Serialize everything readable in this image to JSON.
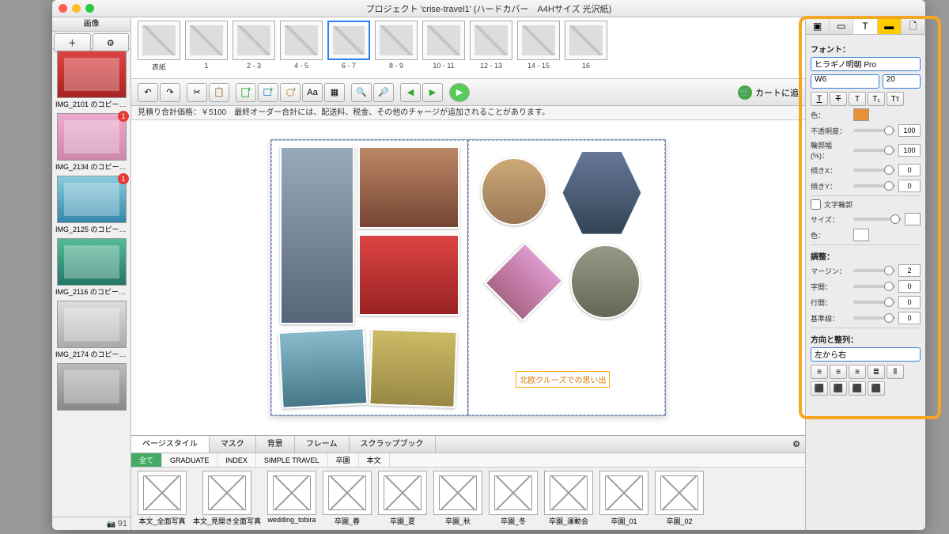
{
  "title": "プロジェクト 'crise-travel1' (ハードカバー　A4Hサイズ 光沢紙)",
  "sidebar": {
    "header": "画像",
    "count": "91",
    "items": [
      {
        "cap": "IMG_2101 のコピー-J...",
        "badge": ""
      },
      {
        "cap": "IMG_2134 のコピー-J...",
        "badge": "1"
      },
      {
        "cap": "IMG_2125 のコピー-J...",
        "badge": "1"
      },
      {
        "cap": "IMG_2116 のコピー-J...",
        "badge": ""
      },
      {
        "cap": "IMG_2174 のコピー-J...",
        "badge": ""
      },
      {
        "cap": "",
        "badge": ""
      }
    ]
  },
  "pages": [
    {
      "label": "表紙"
    },
    {
      "label": "1"
    },
    {
      "label": "2 - 3"
    },
    {
      "label": "4 - 5"
    },
    {
      "label": "6 - 7",
      "sel": true
    },
    {
      "label": "8 - 9"
    },
    {
      "label": "10 - 11"
    },
    {
      "label": "12 - 13"
    },
    {
      "label": "14 - 15"
    },
    {
      "label": "16"
    }
  ],
  "toolbar": {
    "cart": "カートに追"
  },
  "infobar": "見積り合計価格：￥5100　最終オーダー合計には、配送料、税金、その他のチャージが追加されることがあります。",
  "textbox": "北欧クルーズでの思い出",
  "bottomTabs": [
    "ページスタイル",
    "マスク",
    "背景",
    "フレーム",
    "スクラップブック"
  ],
  "filters": [
    "全て",
    "GRADUATE",
    "INDEX",
    "SIMPLE TRAVEL",
    "卒園",
    "本文"
  ],
  "templates": [
    "本文_全面写真",
    "本文_見開き全面写真",
    "wedding_tobira",
    "卒園_春",
    "卒園_夏",
    "卒園_秋",
    "卒園_冬",
    "卒園_運動会",
    "卒園_01",
    "卒園_02"
  ],
  "insp": {
    "sect_font": "フォント：",
    "font": "ヒラギノ明朝 Pro",
    "weight": "W6",
    "size": "20",
    "lbl_color": "色：",
    "color": "#e89038",
    "lbl_opacity": "不透明度：",
    "opacity": "100",
    "lbl_scale": "輪郭幅 (%)：",
    "scale": "100",
    "lbl_skx": "傾きX：",
    "skx": "0",
    "lbl_sky": "傾きY：",
    "sky": "0",
    "chk_outline": "文字輪郭",
    "lbl_size2": "サイズ：",
    "lbl_color2": "色：",
    "sect_adjust": "調整：",
    "lbl_margin": "マージン：",
    "margin": "2",
    "lbl_char": "字間：",
    "char": "0",
    "lbl_line": "行間：",
    "line": "0",
    "lbl_base": "基準線：",
    "base": "0",
    "sect_dir": "方向と整列：",
    "dir": "左から右"
  }
}
